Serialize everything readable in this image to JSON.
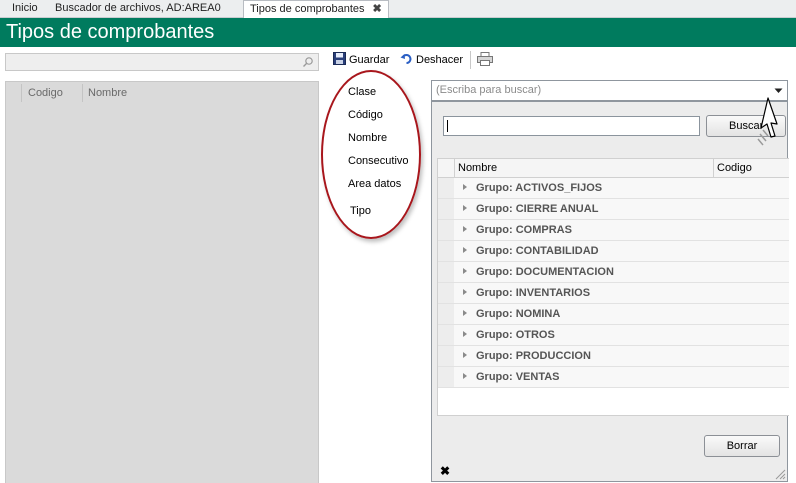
{
  "tabs": [
    {
      "label": "Inicio",
      "active": false
    },
    {
      "label": "Buscador de archivos, AD:AREA0",
      "active": false
    },
    {
      "label": "Tipos de comprobantes",
      "active": true,
      "close": "✖"
    }
  ],
  "header": {
    "title": "Tipos de comprobantes",
    "color": "#007b5e"
  },
  "left_panel": {
    "search_icon": "search-icon",
    "grid": {
      "columns": [
        "Codigo",
        "Nombre"
      ]
    }
  },
  "toolbar": {
    "save_label": "Guardar",
    "undo_label": "Deshacer",
    "print_icon": "printer-icon"
  },
  "form": {
    "labels": [
      "Clase",
      "Código",
      "Nombre",
      "Consecutivo",
      "Area datos",
      "Tipo"
    ]
  },
  "combo": {
    "placeholder": "(Escriba para buscar)"
  },
  "dropdown": {
    "search_value": "",
    "search_button": "Buscar",
    "columns": [
      "Nombre",
      "Codigo"
    ],
    "groups": [
      "Grupo: ACTIVOS_FIJOS",
      "Grupo: CIERRE ANUAL",
      "Grupo: COMPRAS",
      "Grupo: CONTABILIDAD",
      "Grupo: DOCUMENTACION",
      "Grupo: INVENTARIOS",
      "Grupo: NOMINA",
      "Grupo: OTROS",
      "Grupo: PRODUCCION",
      "Grupo: VENTAS"
    ],
    "clear_button": "Borrar",
    "close_glyph": "✖"
  },
  "annotation_color": "#a8161c"
}
